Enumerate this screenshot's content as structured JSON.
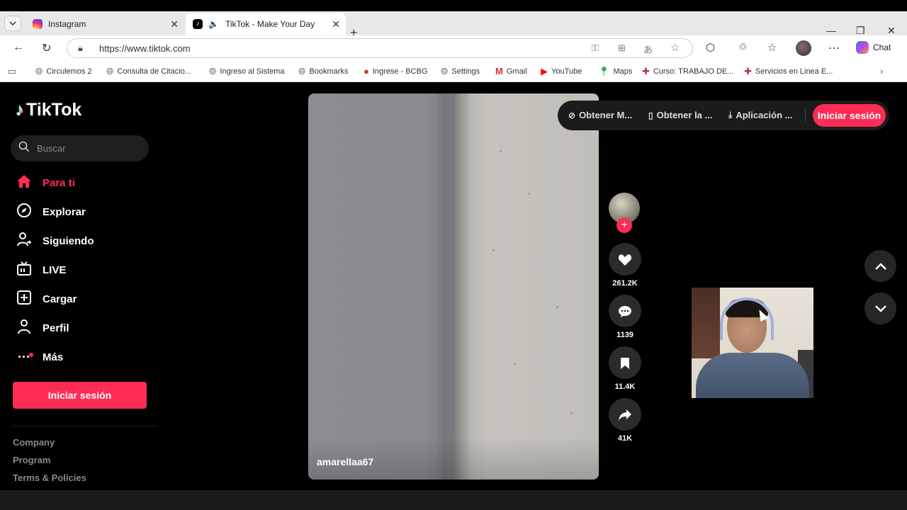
{
  "browser": {
    "tabs": [
      {
        "title": "Instagram",
        "active": false,
        "favicon": "instagram-icon",
        "color": "#d62976"
      },
      {
        "title": "TikTok - Make Your Day",
        "active": true,
        "favicon": "tiktok-icon",
        "color": "#000000"
      }
    ],
    "url": "https://www.tiktok.com",
    "chat_label": "Chat",
    "bookmarks": [
      {
        "label": "Circulemos 2",
        "icon": "globe-icon"
      },
      {
        "label": "Consulta de Citacio...",
        "icon": "globe-icon"
      },
      {
        "label": "Ingreso al Sistema",
        "icon": "globe-icon"
      },
      {
        "label": "Bookmarks",
        "icon": "globe-icon"
      },
      {
        "label": "Ingrese - BCBG",
        "icon": "bcbg-icon"
      },
      {
        "label": "Settings",
        "icon": "globe-icon"
      },
      {
        "label": "Gmail",
        "icon": "gmail-icon"
      },
      {
        "label": "YouTube",
        "icon": "youtube-icon"
      },
      {
        "label": "Maps",
        "icon": "maps-icon"
      },
      {
        "label": "Curso: TRABAJO DE...",
        "icon": "cross-icon"
      },
      {
        "label": "Servicios en Linea E...",
        "icon": "cross-icon"
      }
    ]
  },
  "tiktok": {
    "brand": "TikTok",
    "search_placeholder": "Buscar",
    "nav": [
      {
        "label": "Para ti",
        "icon": "home-icon",
        "active": true
      },
      {
        "label": "Explorar",
        "icon": "compass-icon",
        "active": false
      },
      {
        "label": "Siguiendo",
        "icon": "following-icon",
        "active": false
      },
      {
        "label": "LIVE",
        "icon": "live-icon",
        "active": false
      },
      {
        "label": "Cargar",
        "icon": "upload-icon",
        "active": false
      },
      {
        "label": "Perfil",
        "icon": "profile-icon",
        "active": false
      },
      {
        "label": "Más",
        "icon": "more-icon",
        "active": false
      }
    ],
    "login_label": "Iniciar sesión",
    "footer_links": [
      "Company",
      "Program",
      "Terms & Policies"
    ],
    "top_actions": [
      {
        "label": "Obtener M...",
        "icon": "coin-icon"
      },
      {
        "label": "Obtener la ...",
        "icon": "phone-icon"
      },
      {
        "label": "Aplicación ...",
        "icon": "download-icon"
      }
    ],
    "top_login_label": "Iniciar sesión",
    "video": {
      "author": "amarellaa67",
      "likes": "261.2K",
      "comments": "1139",
      "saves": "11.4K",
      "shares": "41K"
    },
    "accent_color": "#fe2c55"
  }
}
